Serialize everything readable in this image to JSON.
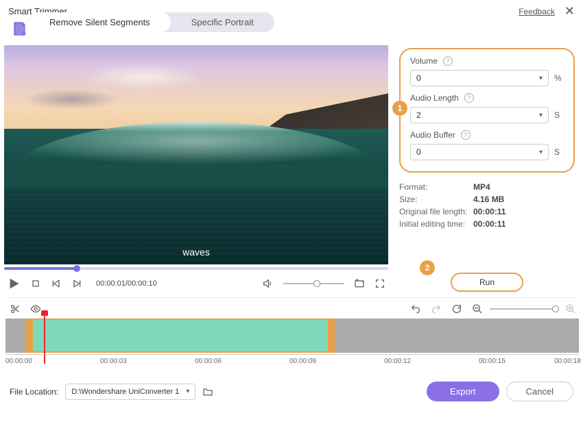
{
  "header": {
    "title": "Smart Trimmer",
    "feedback": "Feedback"
  },
  "tabs": {
    "remove_silent": "Remove Silent Segments",
    "specific_portrait": "Specific Portrait"
  },
  "preview": {
    "caption": "waves",
    "time": "00:00:01/00:00:10"
  },
  "settings": {
    "volume_label": "Volume",
    "volume_value": "0",
    "volume_unit": "%",
    "length_label": "Audio Length",
    "length_value": "2",
    "length_unit": "S",
    "buffer_label": "Audio Buffer",
    "buffer_value": "0",
    "buffer_unit": "S"
  },
  "info": {
    "format_k": "Format:",
    "format_v": "MP4",
    "size_k": "Size:",
    "size_v": "4.16 MB",
    "orig_k": "Original file length:",
    "orig_v": "00:00:11",
    "edit_k": "Initial editing time:",
    "edit_v": "00:00:11"
  },
  "annotations": {
    "b1": "1",
    "b2": "2"
  },
  "run_label": "Run",
  "ruler": {
    "t0": "00:00:00",
    "t1": "00:00:03",
    "t2": "00:00:06",
    "t3": "00:00:09",
    "t4": "00:00:12",
    "t5": "00:00:15",
    "t6": "00:00:18"
  },
  "footer": {
    "file_loc_label": "File Location:",
    "path": "D:\\Wondershare UniConverter 1",
    "export": "Export",
    "cancel": "Cancel"
  }
}
